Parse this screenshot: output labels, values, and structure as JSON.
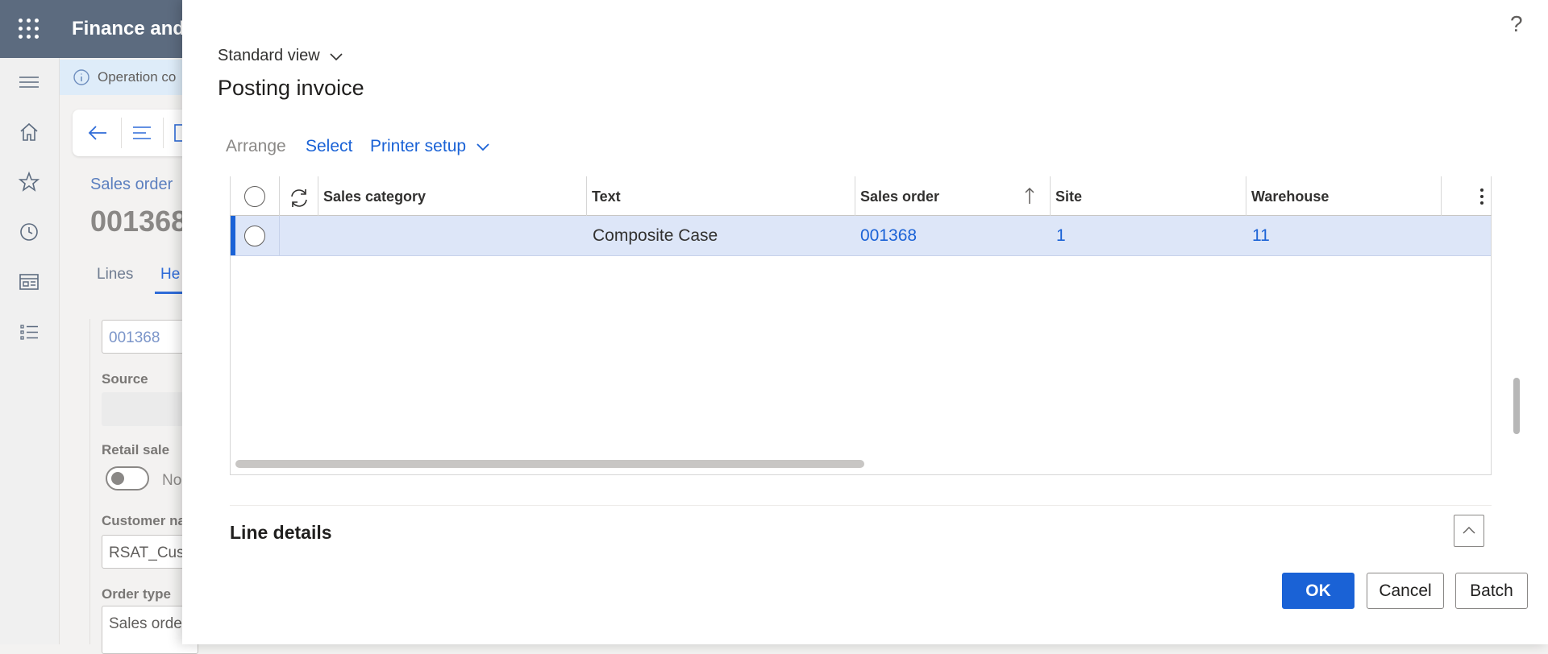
{
  "app": {
    "title": "Finance and",
    "message": "Operation co"
  },
  "background_page": {
    "breadcrumb": "Sales order",
    "record_title": "001368",
    "tabs": [
      "Lines",
      "He"
    ],
    "order_field_value": "001368",
    "source_label": "Source",
    "retail_sale_label": "Retail sale",
    "retail_sale_value": "No",
    "customer_name_label": "Customer na",
    "customer_name_value": "RSAT_Cus",
    "order_type_label": "Order type",
    "order_type_value": "Sales orde"
  },
  "dialog": {
    "help": "?",
    "view_selector": "Standard view",
    "title": "Posting invoice",
    "actions": {
      "arrange": "Arrange",
      "select": "Select",
      "printer_setup": "Printer setup"
    },
    "grid": {
      "columns": [
        "Sales category",
        "Text",
        "Sales order",
        "Site",
        "Warehouse"
      ],
      "sort_column": "Sales order",
      "sort_direction": "ascending",
      "rows": [
        {
          "sales_category": "",
          "text": "Composite Case",
          "sales_order": "001368",
          "site": "1",
          "warehouse": "11",
          "selected": true
        }
      ]
    },
    "line_details": "Line details",
    "buttons": {
      "ok": "OK",
      "cancel": "Cancel",
      "batch": "Batch"
    }
  },
  "colors": {
    "accent": "#1a62d6",
    "topbar": "#5c6b7f",
    "selected_row": "#dde6f8"
  }
}
